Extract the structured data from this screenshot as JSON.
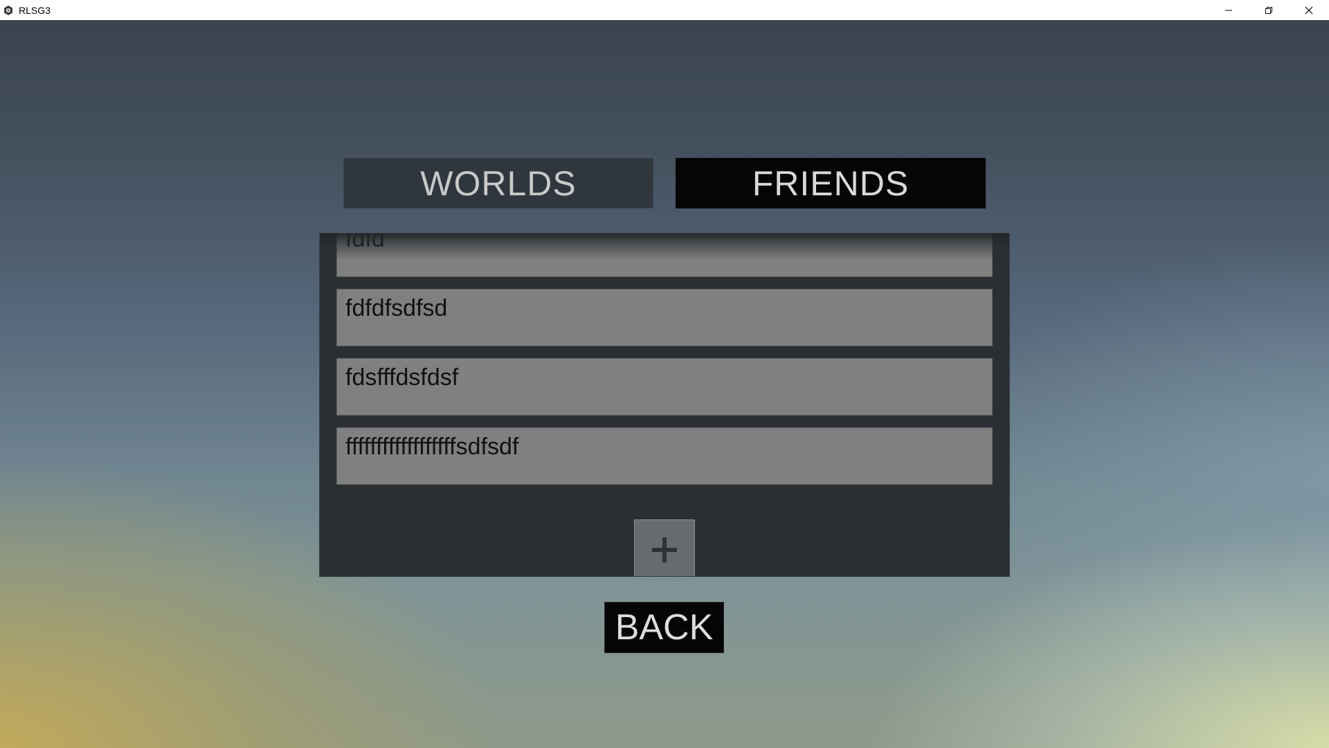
{
  "window": {
    "title": "RLSG3",
    "app_icon": "gear-icon",
    "controls": {
      "minimize_icon": "minimize-icon",
      "restore_icon": "restore-icon",
      "close_icon": "close-icon"
    }
  },
  "tabs": [
    {
      "label": "WORLDS",
      "active": false
    },
    {
      "label": "FRIENDS",
      "active": true
    }
  ],
  "friends_list": {
    "items": [
      {
        "label": "fdfd"
      },
      {
        "label": "fdfdfsdfsd"
      },
      {
        "label": "fdsfffdsfdsf"
      },
      {
        "label": "ffffffffffffffffffsdfsdf"
      }
    ],
    "add_button_icon": "plus-icon"
  },
  "back_button": {
    "label": "BACK"
  },
  "colors": {
    "active_tab_bg": "#050505",
    "inactive_tab_bg": "#2f363e",
    "panel_bg": "#2a2f34",
    "item_bg": "#808080"
  }
}
